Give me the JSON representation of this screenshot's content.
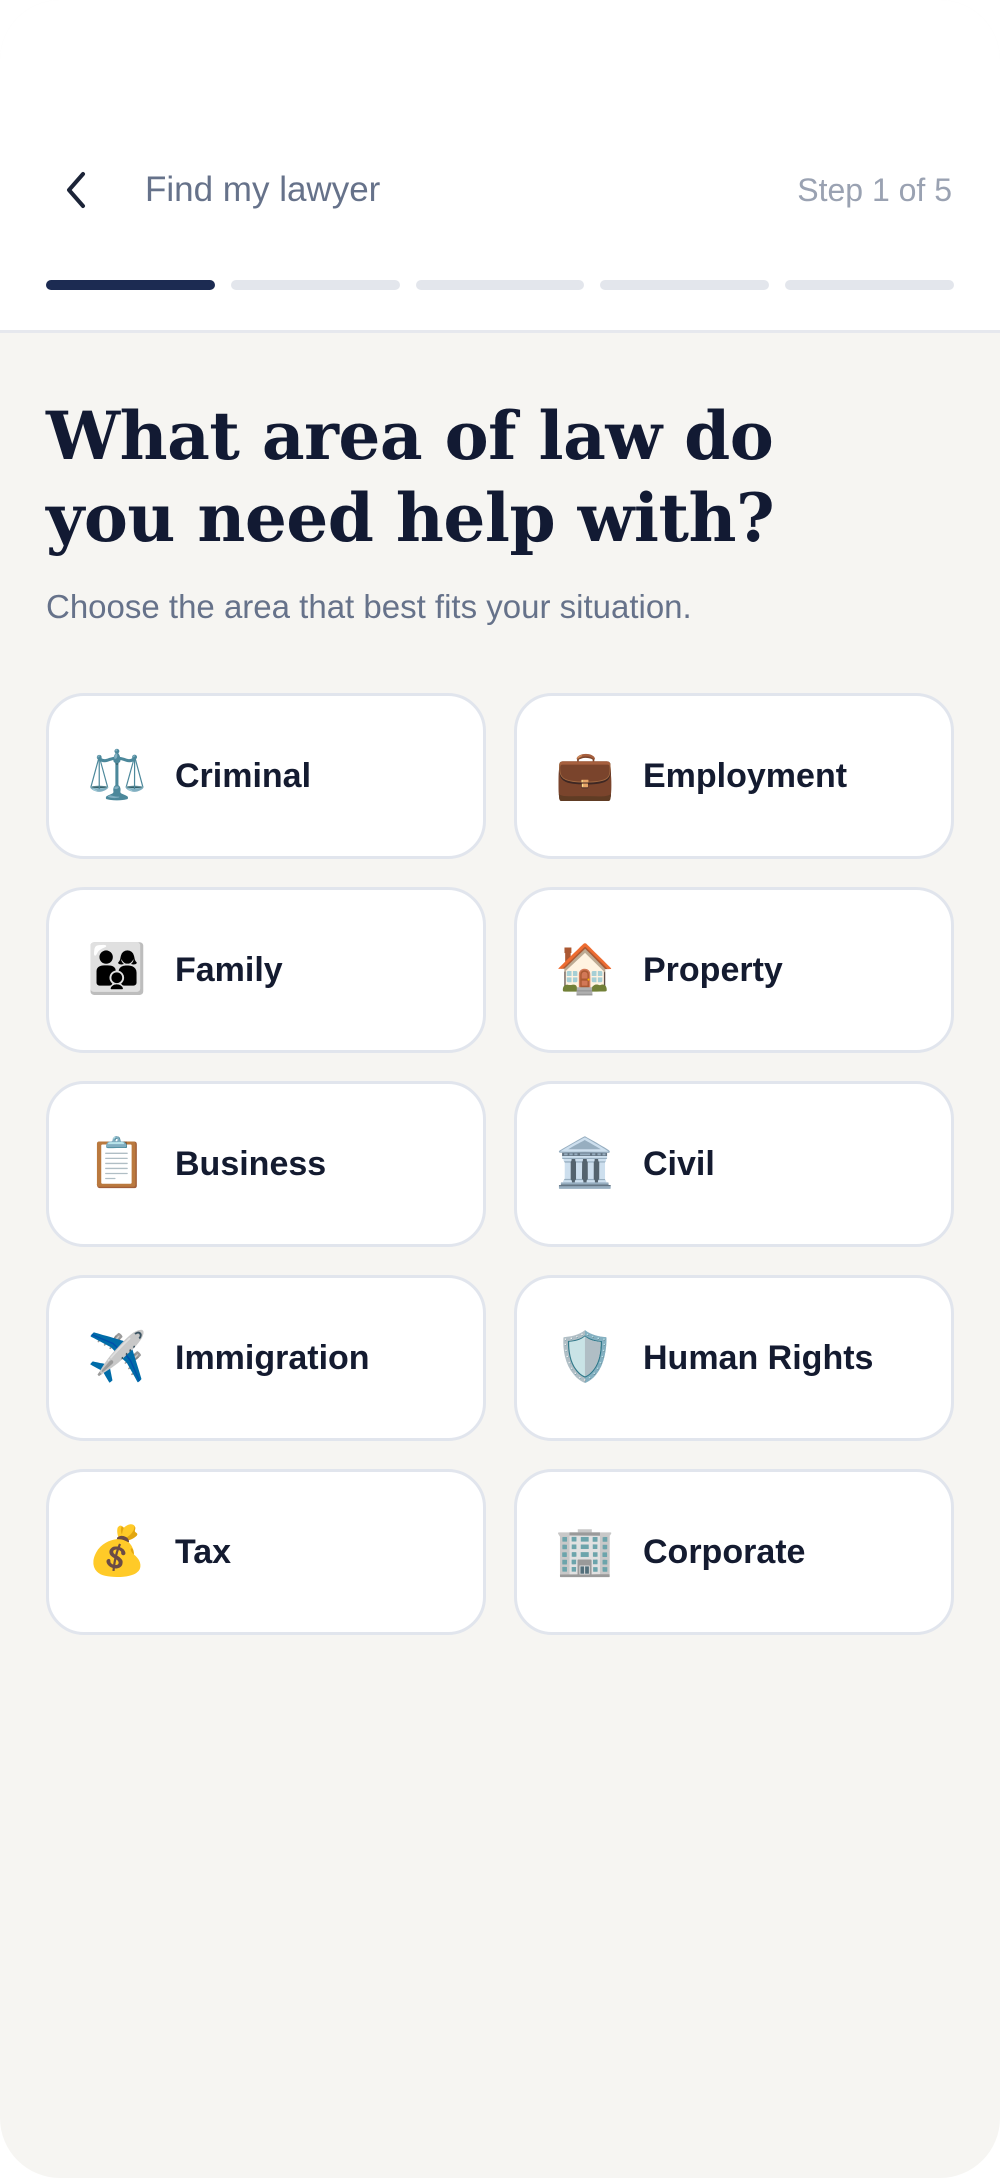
{
  "header": {
    "title": "Find my lawyer",
    "step": "Step 1 of 5",
    "progress": {
      "current_step": 1,
      "total_steps": 5
    }
  },
  "main": {
    "headline": "What area of law do you need help with?",
    "subtitle": "Choose the area that best fits your situation.",
    "areas": [
      {
        "label": "Criminal",
        "icon": "⚖️",
        "icon_name": "scales-icon"
      },
      {
        "label": "Employment",
        "icon": "💼",
        "icon_name": "briefcase-icon"
      },
      {
        "label": "Family",
        "icon": "👨‍👩‍👦",
        "icon_name": "family-icon"
      },
      {
        "label": "Property",
        "icon": "🏠",
        "icon_name": "house-icon"
      },
      {
        "label": "Business",
        "icon": "📋",
        "icon_name": "clipboard-icon"
      },
      {
        "label": "Civil",
        "icon": "🏛️",
        "icon_name": "classical-building-icon"
      },
      {
        "label": "Immigration",
        "icon": "✈️",
        "icon_name": "airplane-icon"
      },
      {
        "label": "Human Rights",
        "icon": "🛡️",
        "icon_name": "shield-icon"
      },
      {
        "label": "Tax",
        "icon": "💰",
        "icon_name": "money-bag-icon"
      },
      {
        "label": "Corporate",
        "icon": "🏢",
        "icon_name": "office-building-icon"
      }
    ]
  },
  "colors": {
    "accent": "#1c2b52",
    "progress_inactive": "#e3e6ec",
    "background": "#f6f5f2",
    "card_border": "#e1e5ed"
  }
}
